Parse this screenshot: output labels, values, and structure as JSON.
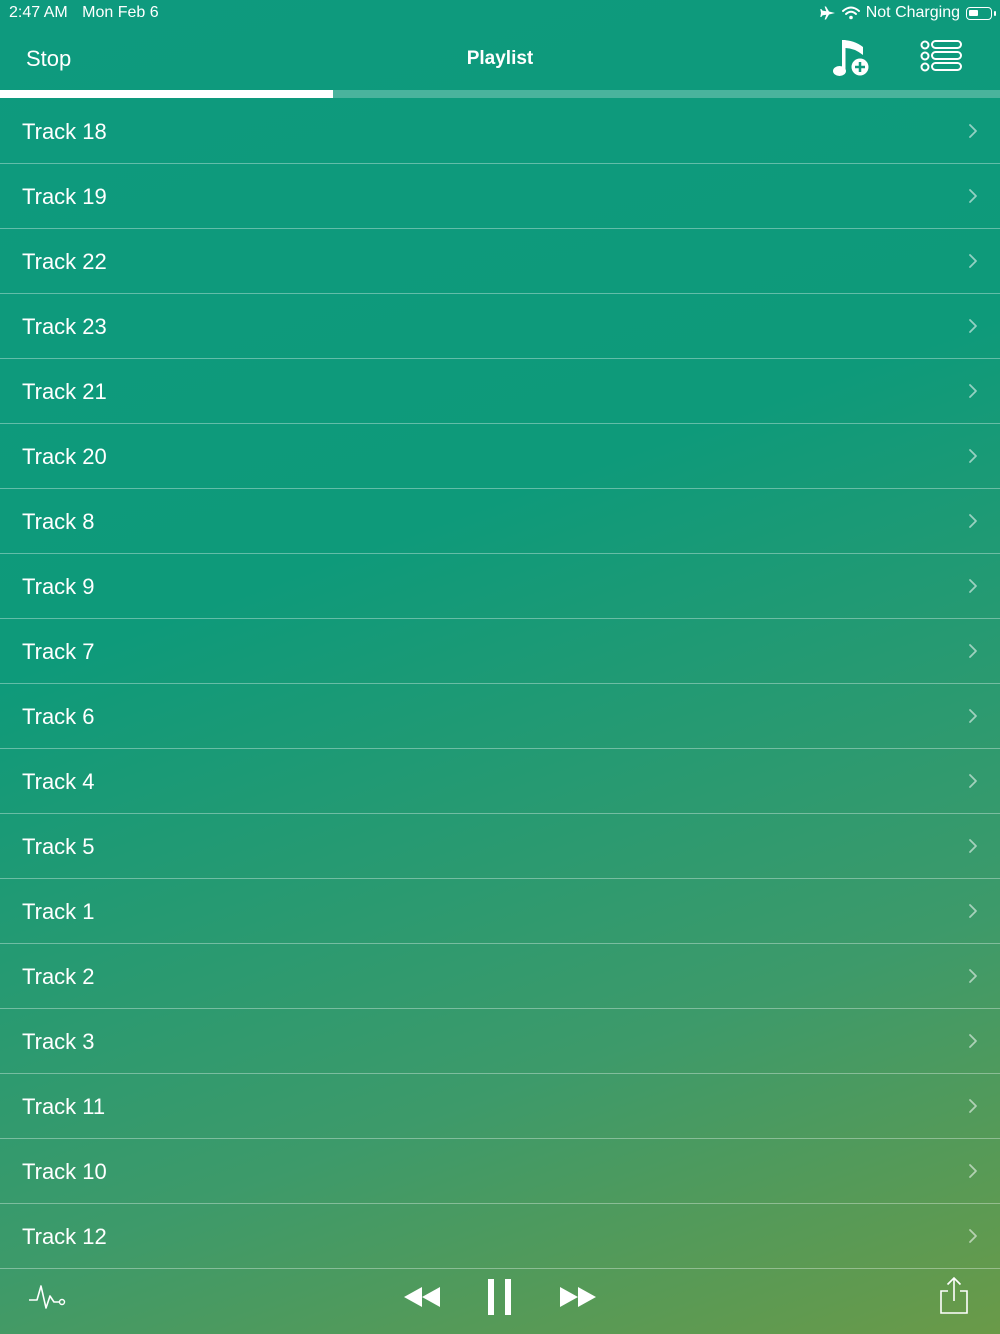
{
  "status_bar": {
    "time": "2:47 AM",
    "date": "Mon Feb 6",
    "charging": "Not Charging",
    "icons": [
      "airplane-icon",
      "wifi-icon",
      "battery-icon"
    ]
  },
  "nav": {
    "stop_label": "Stop",
    "title": "Playlist",
    "icons": [
      "add-music-icon",
      "playlist-menu-icon"
    ]
  },
  "playback": {
    "progress": 0.333
  },
  "tracks": [
    {
      "label": "Track 18"
    },
    {
      "label": "Track 19"
    },
    {
      "label": "Track 22"
    },
    {
      "label": "Track 23"
    },
    {
      "label": "Track 21"
    },
    {
      "label": "Track 20"
    },
    {
      "label": "Track 8"
    },
    {
      "label": "Track 9"
    },
    {
      "label": "Track 7"
    },
    {
      "label": "Track 6"
    },
    {
      "label": "Track 4"
    },
    {
      "label": "Track 5"
    },
    {
      "label": "Track 1"
    },
    {
      "label": "Track 2"
    },
    {
      "label": "Track 3"
    },
    {
      "label": "Track 11"
    },
    {
      "label": "Track 10"
    },
    {
      "label": "Track 12"
    }
  ],
  "toolbar": {
    "icons": [
      "waveform-icon",
      "rewind-icon",
      "pause-icon",
      "fast-forward-icon",
      "share-icon"
    ]
  },
  "colors": {
    "gradient_top": "#0e9a7e",
    "gradient_bottom": "#6a9a48",
    "text": "#ffffff"
  }
}
